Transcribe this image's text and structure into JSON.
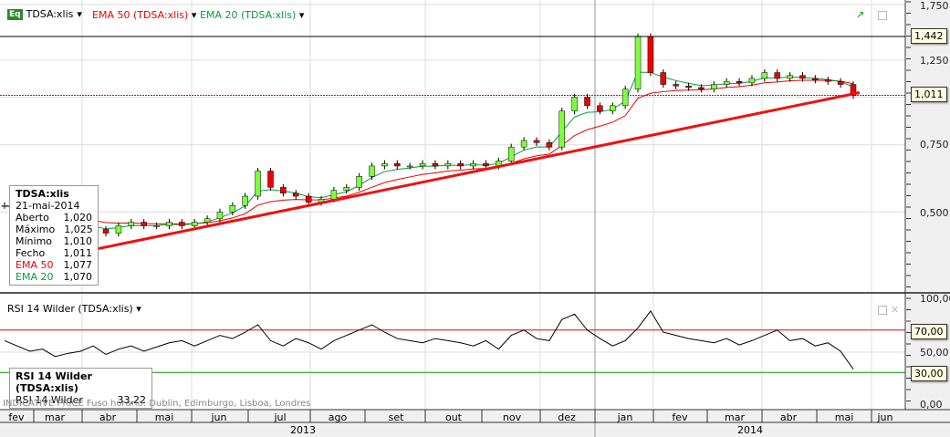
{
  "header": {
    "symbol": "TDSA:xlis",
    "ema50": "EMA 50 (TDSA:xlis)",
    "ema20": "EMA 20 (TDSA:xlis)",
    "eq_badge": "Eq",
    "rsi": "RSI 14 Wilder (TDSA:xlis)"
  },
  "colors": {
    "ema50": "#ee0000",
    "ema20": "#00a03c",
    "trend": "#ee1111",
    "rsi_hi": "#ee0000",
    "rsi_lo": "#009900"
  },
  "tooltip": {
    "title": "TDSA:xlis",
    "date": "21-mai-2014",
    "rows": [
      {
        "label": "Aberto",
        "value": "1,020"
      },
      {
        "label": "Máximo",
        "value": "1,025"
      },
      {
        "label": "Mínimo",
        "value": "1,010"
      },
      {
        "label": "Fecho",
        "value": "1,011"
      },
      {
        "label": "EMA 50",
        "value": "1,077"
      },
      {
        "label": "EMA 20",
        "value": "1,070"
      }
    ]
  },
  "rsi_tooltip": {
    "title": "RSI 14 Wilder (TDSA:xlis)",
    "label": "RSI 14 Wilder",
    "value": "33,22"
  },
  "price_tags": {
    "high": "1,442",
    "last": "1,011"
  },
  "price_axis": [
    "1,750",
    "1,250",
    "1,011",
    "0,750",
    "0,500"
  ],
  "rsi_axis": [
    "100,00",
    "70,00",
    "50,00",
    "30,00",
    "0,00"
  ],
  "note": "INDICATIVE PRICE   Fuso horário: Dublin, Edimburgo, Lisboa, Londres",
  "months": [
    "fev",
    "mar",
    "abr",
    "mai",
    "jun",
    "jul",
    "ago",
    "set",
    "out",
    "nov",
    "dez",
    "jan",
    "fev",
    "mar",
    "abr",
    "mai",
    "jun"
  ],
  "years": [
    "2013",
    "2014"
  ],
  "chart_data": {
    "type": "line",
    "scale": "log",
    "ylim": [
      0.35,
      1.8
    ],
    "closes": [
      0.52,
      0.49,
      0.47,
      0.46,
      0.45,
      0.47,
      0.46,
      0.45,
      0.44,
      0.46,
      0.47,
      0.46,
      0.46,
      0.47,
      0.46,
      0.47,
      0.48,
      0.5,
      0.52,
      0.55,
      0.64,
      0.58,
      0.56,
      0.55,
      0.53,
      0.54,
      0.57,
      0.58,
      0.62,
      0.66,
      0.67,
      0.66,
      0.66,
      0.67,
      0.66,
      0.67,
      0.66,
      0.67,
      0.66,
      0.68,
      0.74,
      0.77,
      0.76,
      0.74,
      0.92,
      1.0,
      0.95,
      0.92,
      0.95,
      1.05,
      1.44,
      1.16,
      1.08,
      1.07,
      1.06,
      1.05,
      1.08,
      1.1,
      1.09,
      1.12,
      1.16,
      1.12,
      1.14,
      1.12,
      1.11,
      1.1,
      1.08,
      1.01
    ],
    "trendline": [
      0.395,
      1.028
    ],
    "hlines": [
      1.442,
      1.011
    ],
    "rsi": {
      "values": [
        60,
        55,
        50,
        52,
        45,
        48,
        50,
        55,
        47,
        52,
        55,
        50,
        54,
        58,
        60,
        55,
        60,
        65,
        62,
        68,
        75,
        60,
        55,
        62,
        58,
        52,
        60,
        65,
        70,
        75,
        68,
        62,
        60,
        58,
        62,
        60,
        58,
        55,
        60,
        52,
        65,
        70,
        62,
        60,
        80,
        85,
        70,
        62,
        55,
        60,
        72,
        88,
        68,
        65,
        62,
        60,
        58,
        62,
        56,
        60,
        65,
        70,
        60,
        62,
        55,
        58,
        50,
        33
      ],
      "levels": [
        70,
        30
      ],
      "ylim": [
        0,
        100
      ]
    }
  }
}
